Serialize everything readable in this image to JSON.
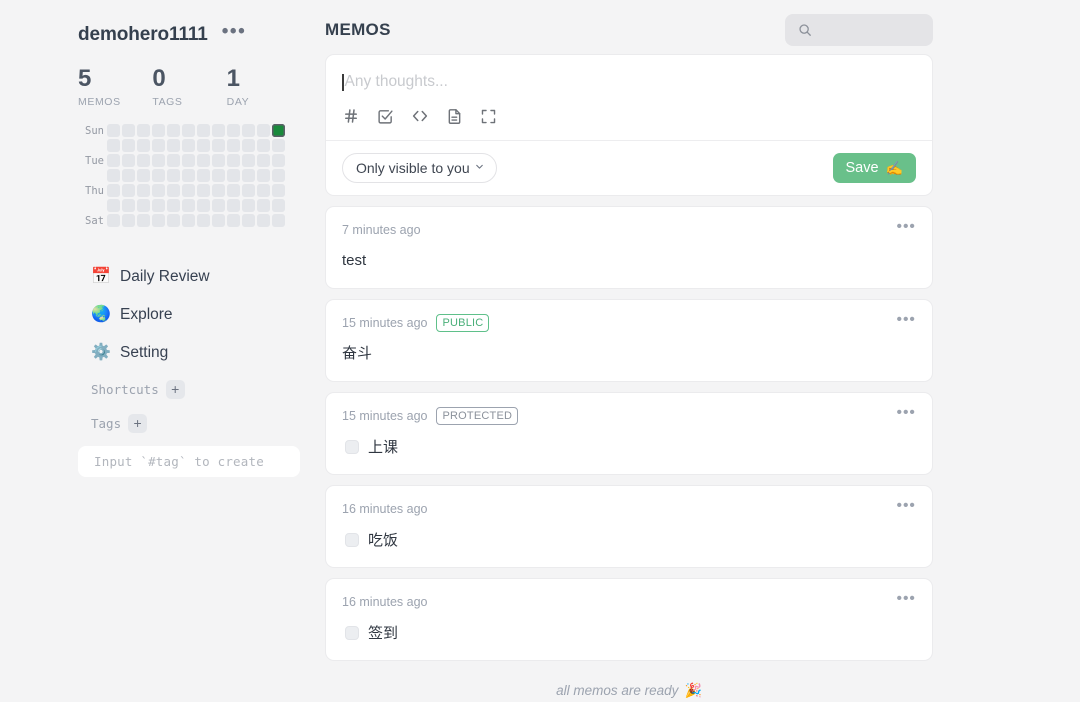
{
  "theme": {
    "page_bg": "#f4f4f5",
    "card_bg": "#ffffff",
    "accent_green": "#69c08a",
    "heatmap_active": "#1a8a3c",
    "heatmap_empty": "#e3e5e9",
    "public_badge": "#4aaf79",
    "muted_text": "#9ca3af"
  },
  "sidebar": {
    "username": "demohero1111",
    "more_icon": "•••",
    "stats": [
      {
        "value": "5",
        "label": "MEMOS"
      },
      {
        "value": "0",
        "label": "TAGS"
      },
      {
        "value": "1",
        "label": "DAY"
      }
    ],
    "heatmap": {
      "day_labels": [
        "Sun",
        "",
        "Tue",
        "",
        "Thu",
        "",
        "Sat"
      ],
      "columns": 12,
      "rows": 7,
      "active_cells": [
        11
      ]
    },
    "nav": [
      {
        "icon": "📅",
        "icon_name": "calendar-icon",
        "label": "Daily Review",
        "key": "daily-review"
      },
      {
        "icon": "🌏",
        "icon_name": "globe-icon",
        "label": "Explore",
        "key": "explore"
      },
      {
        "icon": "⚙️",
        "icon_name": "gear-icon",
        "label": "Setting",
        "key": "setting"
      }
    ],
    "shortcuts": {
      "title": "Shortcuts",
      "add_label": "+"
    },
    "tags": {
      "title": "Tags",
      "add_label": "+",
      "hint": "Input `#tag` to create"
    }
  },
  "main": {
    "title": "MEMOS",
    "search": {
      "placeholder": "",
      "value": "",
      "icon_name": "search-icon"
    },
    "editor": {
      "placeholder": "Any thoughts...",
      "value": "",
      "tools": [
        {
          "name": "hash-icon",
          "glyph": "#"
        },
        {
          "name": "checkbox-icon",
          "glyph": "☑"
        },
        {
          "name": "code-icon",
          "glyph": "<>"
        },
        {
          "name": "document-icon",
          "glyph": "📄"
        },
        {
          "name": "fullscreen-icon",
          "glyph": "⛶"
        }
      ],
      "visibility": {
        "label": "Only visible to you",
        "chevron": "⌄"
      },
      "save": {
        "label": "Save",
        "emoji": "✍️"
      }
    },
    "memos": [
      {
        "time": "7 minutes ago",
        "badge": null,
        "type": "text",
        "text": "test",
        "more_icon": "•••"
      },
      {
        "time": "15 minutes ago",
        "badge": "PUBLIC",
        "badge_kind": "public",
        "type": "text",
        "text": "奋斗",
        "more_icon": "•••"
      },
      {
        "time": "15 minutes ago",
        "badge": "PROTECTED",
        "badge_kind": "protected",
        "type": "todo",
        "text": "上课",
        "checked": false,
        "more_icon": "•••"
      },
      {
        "time": "16 minutes ago",
        "badge": null,
        "type": "todo",
        "text": "吃饭",
        "checked": false,
        "more_icon": "•••"
      },
      {
        "time": "16 minutes ago",
        "badge": null,
        "type": "todo",
        "text": "签到",
        "checked": false,
        "more_icon": "•••"
      }
    ],
    "footer": {
      "text": "all memos are ready",
      "emoji": "🎉"
    }
  }
}
